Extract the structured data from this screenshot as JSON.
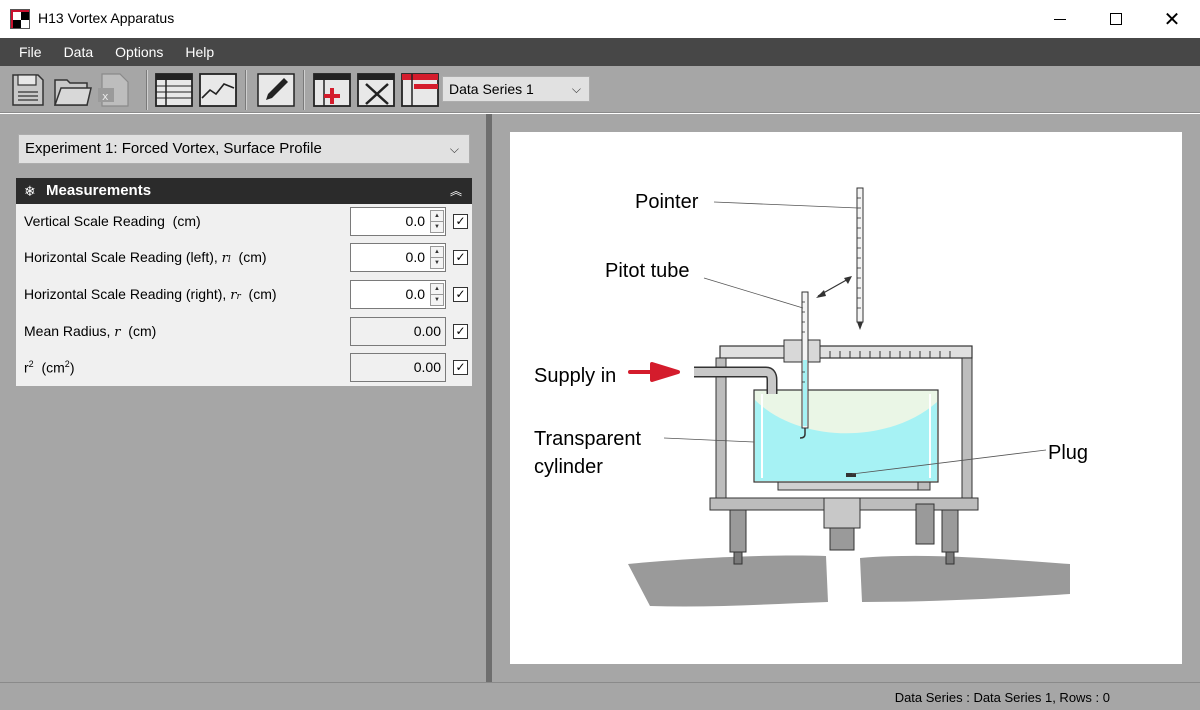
{
  "window": {
    "title": "H13 Vortex Apparatus",
    "icon_text": "HHS"
  },
  "menu": {
    "items": [
      "File",
      "Data",
      "Options",
      "Help"
    ]
  },
  "toolbar": {
    "series_selected": "Data Series 1",
    "icons": [
      "save-icon",
      "open-folder-icon",
      "excel-export-icon",
      "table-icon",
      "chart-icon",
      "pen-icon",
      "add-row-icon",
      "delete-row-icon",
      "clear-table-icon"
    ]
  },
  "experiment": {
    "selected": "Experiment 1: Forced Vortex, Surface Profile"
  },
  "measurements": {
    "title": "Measurements",
    "rows": [
      {
        "label": "Vertical Scale Reading",
        "symbol": "",
        "unit": "(cm)",
        "value": "0.0",
        "editable": true,
        "checked": true
      },
      {
        "label": "Horizontal Scale Reading (left),",
        "symbol": "r",
        "sub": "l",
        "unit": "(cm)",
        "value": "0.0",
        "editable": true,
        "checked": true
      },
      {
        "label": "Horizontal Scale Reading (right),",
        "symbol": "r",
        "sub": "r",
        "unit": "(cm)",
        "value": "0.0",
        "editable": true,
        "checked": true
      },
      {
        "label": "Mean Radius,",
        "symbol": "r",
        "sub": "",
        "unit": "(cm)",
        "value": "0.00",
        "editable": false,
        "checked": true
      },
      {
        "label": "r",
        "symbol": "",
        "sub": "",
        "unit": "(cm",
        "value": "0.00",
        "editable": false,
        "checked": true
      }
    ]
  },
  "diagram": {
    "labels": {
      "pointer": "Pointer",
      "pitot": "Pitot tube",
      "supply": "Supply in",
      "cylinder_1": "Transparent",
      "cylinder_2": "cylinder",
      "plug": "Plug"
    },
    "colors": {
      "water": "#a6f2f4",
      "air": "#eaf6e6",
      "arrow": "#d41c2c",
      "gray": "#9a9a9a"
    }
  },
  "status": {
    "text": "Data Series : Data Series 1,  Rows : 0"
  }
}
